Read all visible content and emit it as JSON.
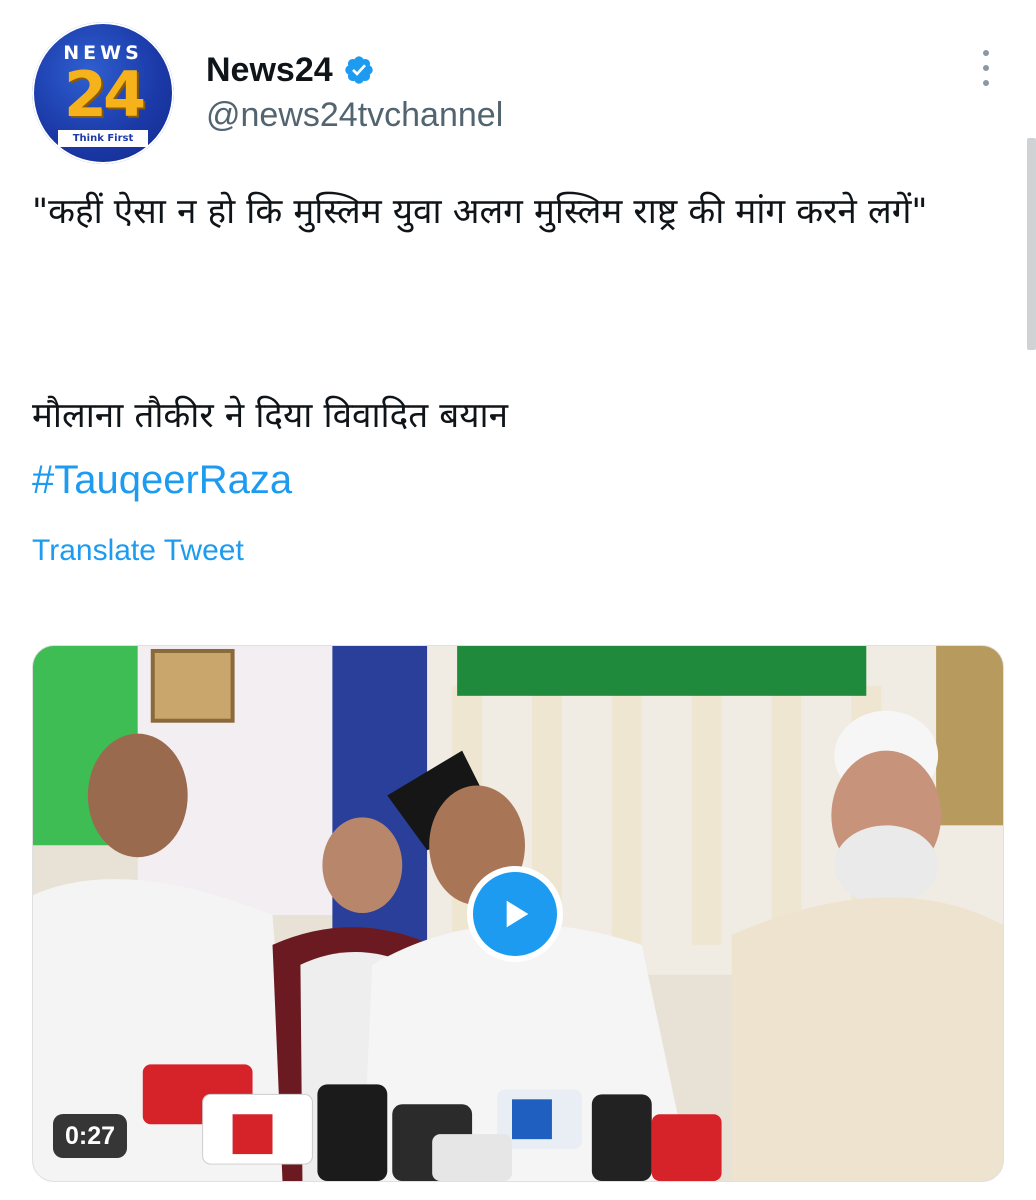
{
  "account": {
    "avatar_text_top": "NEWS",
    "avatar_text_main": "24",
    "avatar_tagline": "Think First",
    "display_name": "News24",
    "handle": "@news24tvchannel",
    "verified": true
  },
  "tweet": {
    "quote": "\"कहीं ऐसा न हो कि मुस्लिम युवा अलग मुस्लिम राष्ट्र की मांग करने लगें\"",
    "line2": "मौलाना तौकीर ने दिया विवादित बयान",
    "hashtag": "#TauqeerRaza",
    "translate_label": "Translate Tweet"
  },
  "media": {
    "type": "video",
    "duration": "0:27"
  },
  "colors": {
    "accent": "#1d9bf0",
    "text": "#0f1419",
    "muted": "#536471"
  }
}
